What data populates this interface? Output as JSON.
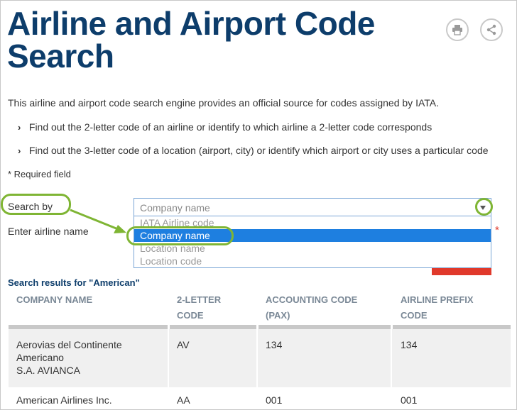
{
  "page": {
    "title": "Airline and Airport Code Search",
    "intro": "This airline and airport code search engine provides an official source for codes assigned by IATA.",
    "bullets": [
      "Find out the 2-letter code of an airline or identify to which airline a 2-letter code corresponds",
      "Find out the 3-letter code of a location (airport, city) or identify which airport or city uses a particular code"
    ],
    "required_note": "* Required field"
  },
  "toolbar": {
    "print_icon": "print-icon",
    "share_icon": "share-icon"
  },
  "form": {
    "search_by_label": "Search by",
    "enter_label": "Enter airline name",
    "select_value": "Company name",
    "options": [
      "IATA Airline code",
      "Company name",
      "Location name",
      "Location code"
    ],
    "highlighted_option": "Company name",
    "required_star": "*"
  },
  "results": {
    "heading": "Search results for \"American\"",
    "columns": [
      [
        "COMPANY NAME"
      ],
      [
        "2-LETTER",
        "CODE"
      ],
      [
        "ACCOUNTING CODE",
        "(PAX)"
      ],
      [
        "AIRLINE PREFIX",
        "CODE"
      ]
    ],
    "rows": [
      {
        "company": [
          "Aerovias del Continente",
          "Americano",
          "S.A. AVIANCA"
        ],
        "code2": "AV",
        "accounting": "134",
        "prefix": "134"
      },
      {
        "company": [
          "American Airlines Inc."
        ],
        "code2": "AA",
        "accounting": "001",
        "prefix": "001"
      }
    ]
  },
  "colors": {
    "title": "#0d3d6b",
    "highlight": "#1e7fe0",
    "annotation": "#7fb534",
    "required": "#e0392b"
  }
}
